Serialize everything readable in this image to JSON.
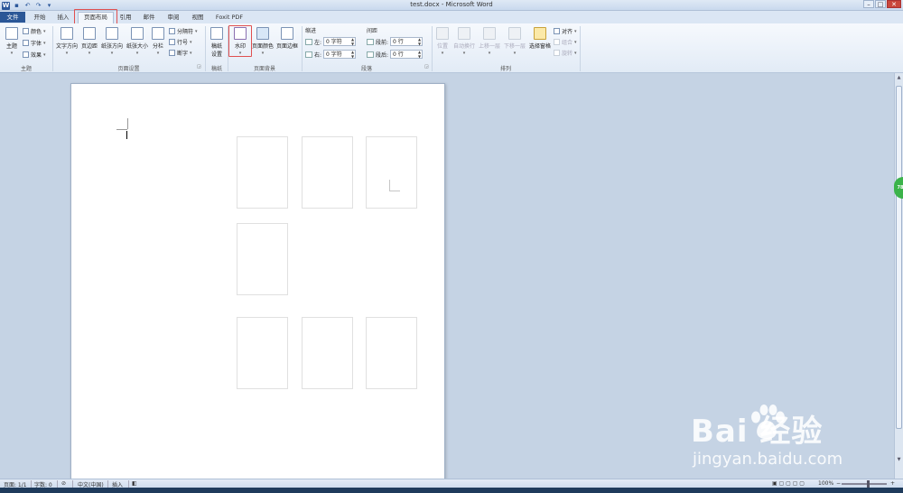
{
  "window": {
    "title": "test.docx - Microsoft Word",
    "app_icon": "W"
  },
  "tabs": [
    {
      "label": "文件",
      "name": "tab-file"
    },
    {
      "label": "开始",
      "name": "tab-home"
    },
    {
      "label": "插入",
      "name": "tab-insert"
    },
    {
      "label": "页面布局",
      "name": "tab-page-layout",
      "active": true
    },
    {
      "label": "引用",
      "name": "tab-references"
    },
    {
      "label": "邮件",
      "name": "tab-mailings"
    },
    {
      "label": "审阅",
      "name": "tab-review"
    },
    {
      "label": "视图",
      "name": "tab-view"
    },
    {
      "label": "Foxit PDF",
      "name": "tab-foxit-pdf"
    }
  ],
  "ribbon": {
    "theme_group": {
      "label": "主题",
      "theme_btn": "主题",
      "colors": "颜色",
      "fonts": "字体",
      "effects": "效果"
    },
    "page_setup_group": {
      "label": "页面设置",
      "text_direction": "文字方向",
      "margins": "页边距",
      "orientation": "纸张方向",
      "size": "纸张大小",
      "columns": "分栏",
      "breaks": "分隔符",
      "line_numbers": "行号",
      "hyphenation": "断字"
    },
    "draft_group": {
      "label": "稿纸",
      "draft_settings_line1": "稿纸",
      "draft_settings_line2": "设置"
    },
    "page_background_group": {
      "label": "页面背景",
      "watermark": "水印",
      "page_color": "页面颜色",
      "page_borders": "页面边框"
    },
    "paragraph_group": {
      "label": "段落",
      "indent_title": "缩进",
      "spacing_title": "间距",
      "indent_left_label": "左:",
      "indent_left_value": "0 字符",
      "indent_right_label": "右:",
      "indent_right_value": "0 字符",
      "spacing_before_label": "段前:",
      "spacing_before_value": "0 行",
      "spacing_after_label": "段后:",
      "spacing_after_value": "0 行"
    },
    "arrange_group": {
      "label": "排列",
      "position": "位置",
      "wrap_text": "自动换行",
      "bring_forward": "上移一层",
      "send_backward": "下移一层",
      "selection_pane": "选择窗格",
      "align": "对齐",
      "group": "组合",
      "rotate": "旋转"
    }
  },
  "statusbar": {
    "page": "页面: 1/1",
    "words": "字数: 0",
    "language": "中文(中国)",
    "mode": "插入",
    "zoom": "100%"
  },
  "overlay": {
    "brand": "Bai  经验",
    "brand_sub": "jingyan.baidu.com"
  },
  "colors": {
    "file_tab": "#2b5797",
    "highlight_red": "#e05050",
    "workspace": "#c5d3e4"
  }
}
